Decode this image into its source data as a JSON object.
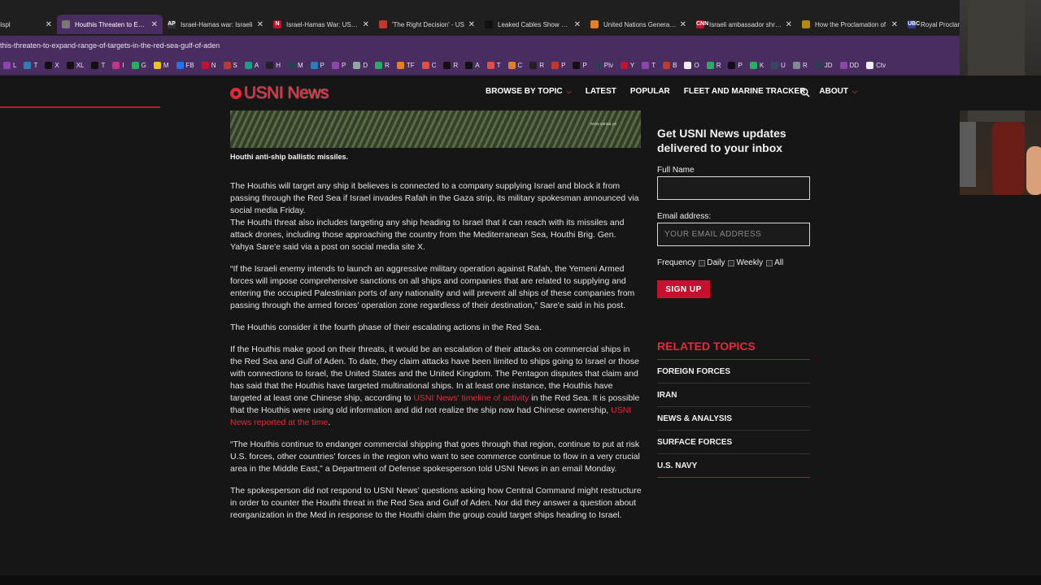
{
  "browser": {
    "tabs": [
      {
        "label": "ead says displ",
        "icon": "",
        "color": "#555555",
        "active": false
      },
      {
        "label": "Houthis Threaten to Expa",
        "icon": "",
        "color": "#777777",
        "active": true
      },
      {
        "label": "Israel-Hamas war: Israeli",
        "icon": "AP",
        "color": "#333333",
        "active": false
      },
      {
        "label": "Israel-Hamas War: US Sen",
        "icon": "N",
        "color": "#c8102e",
        "active": false
      },
      {
        "label": "'The Right Decision' - US",
        "icon": "",
        "color": "#c0392b",
        "active": false
      },
      {
        "label": "Leaked Cables Show Whit",
        "icon": "",
        "color": "#111111",
        "active": false
      },
      {
        "label": "United Nations General A",
        "icon": "",
        "color": "#e67e22",
        "active": false
      },
      {
        "label": "Israeli ambassador shredd",
        "icon": "CNN",
        "color": "#c8102e",
        "active": false
      },
      {
        "label": "How the Proclamation of",
        "icon": "",
        "color": "#b58b00",
        "active": false
      },
      {
        "label": "Royal Proclama",
        "icon": "UBC",
        "color": "#2c3e8f",
        "active": false
      }
    ],
    "url": "this-threaten-to-expand-range-of-targets-in-the-red-sea-gulf-of-aden",
    "bookmarks": [
      {
        "label": "L",
        "color": "#8e44ad"
      },
      {
        "label": "T",
        "color": "#2980b9"
      },
      {
        "label": "X",
        "color": "#111111"
      },
      {
        "label": "XL",
        "color": "#111111"
      },
      {
        "label": "T",
        "color": "#111111"
      },
      {
        "label": "I",
        "color": "#c13584"
      },
      {
        "label": "G",
        "color": "#27ae60"
      },
      {
        "label": "M",
        "color": "#f1c40f"
      },
      {
        "label": "FB",
        "color": "#1877f2"
      },
      {
        "label": "N",
        "color": "#c8102e"
      },
      {
        "label": "S",
        "color": "#c0392b"
      },
      {
        "label": "A",
        "color": "#16a085"
      },
      {
        "label": "H",
        "color": "#222222"
      },
      {
        "label": "M",
        "color": "#2c3e50"
      },
      {
        "label": "P",
        "color": "#2980b9"
      },
      {
        "label": "P",
        "color": "#8e44ad"
      },
      {
        "label": "D",
        "color": "#95a5a6"
      },
      {
        "label": "R",
        "color": "#27ae60"
      },
      {
        "label": "TF",
        "color": "#e67e22"
      },
      {
        "label": "C",
        "color": "#e74c3c"
      },
      {
        "label": "R",
        "color": "#111111"
      },
      {
        "label": "A",
        "color": "#111111"
      },
      {
        "label": "T",
        "color": "#e74c3c"
      },
      {
        "label": "C",
        "color": "#e67e22"
      },
      {
        "label": "R",
        "color": "#222222"
      },
      {
        "label": "P",
        "color": "#c0392b"
      },
      {
        "label": "P",
        "color": "#111111"
      },
      {
        "label": "Plv",
        "color": "#2c3e50"
      },
      {
        "label": "Y",
        "color": "#c8102e"
      },
      {
        "label": "T",
        "color": "#8e44ad"
      },
      {
        "label": "B",
        "color": "#c0392b"
      },
      {
        "label": "O",
        "color": "#ecf0f1"
      },
      {
        "label": "R",
        "color": "#27ae60"
      },
      {
        "label": "P",
        "color": "#111111"
      },
      {
        "label": "K",
        "color": "#27ae60"
      },
      {
        "label": "U",
        "color": "#34495e"
      },
      {
        "label": "R",
        "color": "#7f8c8d"
      },
      {
        "label": "JD",
        "color": "#2c3e50"
      },
      {
        "label": "DD",
        "color": "#8e44ad"
      },
      {
        "label": "Ctv",
        "color": "#ecf0f1"
      }
    ]
  },
  "header": {
    "logo_text": "USNI News",
    "nav": [
      {
        "label": "BROWSE BY TOPIC",
        "dropdown": true
      },
      {
        "label": "LATEST",
        "dropdown": false
      },
      {
        "label": "POPULAR",
        "dropdown": false
      },
      {
        "label": "FLEET AND MARINE TRACKER",
        "dropdown": false
      },
      {
        "label": "ABOUT",
        "dropdown": true
      }
    ],
    "reading_progress": 0.154
  },
  "article": {
    "image_watermark": "www.sanaa.ye",
    "caption": "Houthi anti-ship ballistic missiles.",
    "paragraphs": [
      {
        "text": "The Houthis will target any ship it believes is connected to a company supplying Israel and block it from passing through the Red Sea if Israel invades Rafah in the Gaza strip, its military spokesman announced via social media Friday.",
        "gap": false
      },
      {
        "text": "The Houthi threat also includes targeting any ship heading to Israel that it can reach with its missiles and attack drones, including those approaching the country from the Mediterranean Sea, Houthi Brig. Gen. Yahya Sare'e said via a post on social media site X.",
        "gap": true
      },
      {
        "text": "“If the Israeli enemy intends to launch an aggressive military operation against Rafah, the Yemeni Armed forces will impose comprehensive sanctions on all ships and companies that are related to supplying and entering the occupied Palestinian ports of any nationality and will prevent all ships of these companies from passing through the armed forces’ operation zone regardless of their destination,” Sare'e said in his post.",
        "gap": true
      },
      {
        "text": "The Houthis consider it the fourth phase of their escalating actions in the Red Sea.",
        "gap": true
      }
    ],
    "p5_part1": "If the Houthis make good on their threats, it would be an escalation of their attacks on commercial ships in the Red Sea and Gulf of Aden. To date, they claim attacks have been limited to ships going to Israel or those with connections to Israel, the United States and the United Kingdom. The Pentagon disputes that claim and has said that the Houthis have targeted multinational ships. In at least one instance, the Houthis have targeted at least one Chinese ship, according to ",
    "p5_link1": "USNI News' timeline of activity",
    "p5_part2": " in the Red Sea. It is possible that the Houthis were using old information and did not realize the ship now had Chinese ownership, ",
    "p5_link2": "USNI News reported at the time",
    "p5_part3": ".",
    "p6": "“The Houthis continue to endanger commercial shipping that goes through that region, continue to put at risk U.S. forces, other countries’ forces in the region who want to see commerce continue to flow in a very crucial area in the Middle East,” a Department of Defense spokesperson told USNI News in an email Monday.",
    "p7": "The spokesperson did not respond to USNI News’ questions asking how Central Command might restructure in order to counter the Houthi threat in the Red Sea and Gulf of Aden. Nor did they answer a question about reorganization in the Med in response to the Houthi claim the group could target ships heading to Israel."
  },
  "sidebar": {
    "newsletter_title": "Get USNI News updates delivered to your inbox",
    "full_name_label": "Full Name",
    "full_name_value": "",
    "email_label": "Email address:",
    "email_placeholder": "YOUR EMAIL ADDRESS",
    "frequency_label": "Frequency",
    "frequency_options": [
      "Daily",
      "Weekly",
      "All"
    ],
    "signup_label": "SIGN UP",
    "related_title": "RELATED TOPICS",
    "related_topics": [
      "FOREIGN FORCES",
      "IRAN",
      "NEWS & ANALYSIS",
      "SURFACE FORCES",
      "U.S. NAVY"
    ]
  },
  "colors": {
    "accent": "#e8283a",
    "browser_purple": "#4a2d60",
    "page_background": "#161616"
  }
}
